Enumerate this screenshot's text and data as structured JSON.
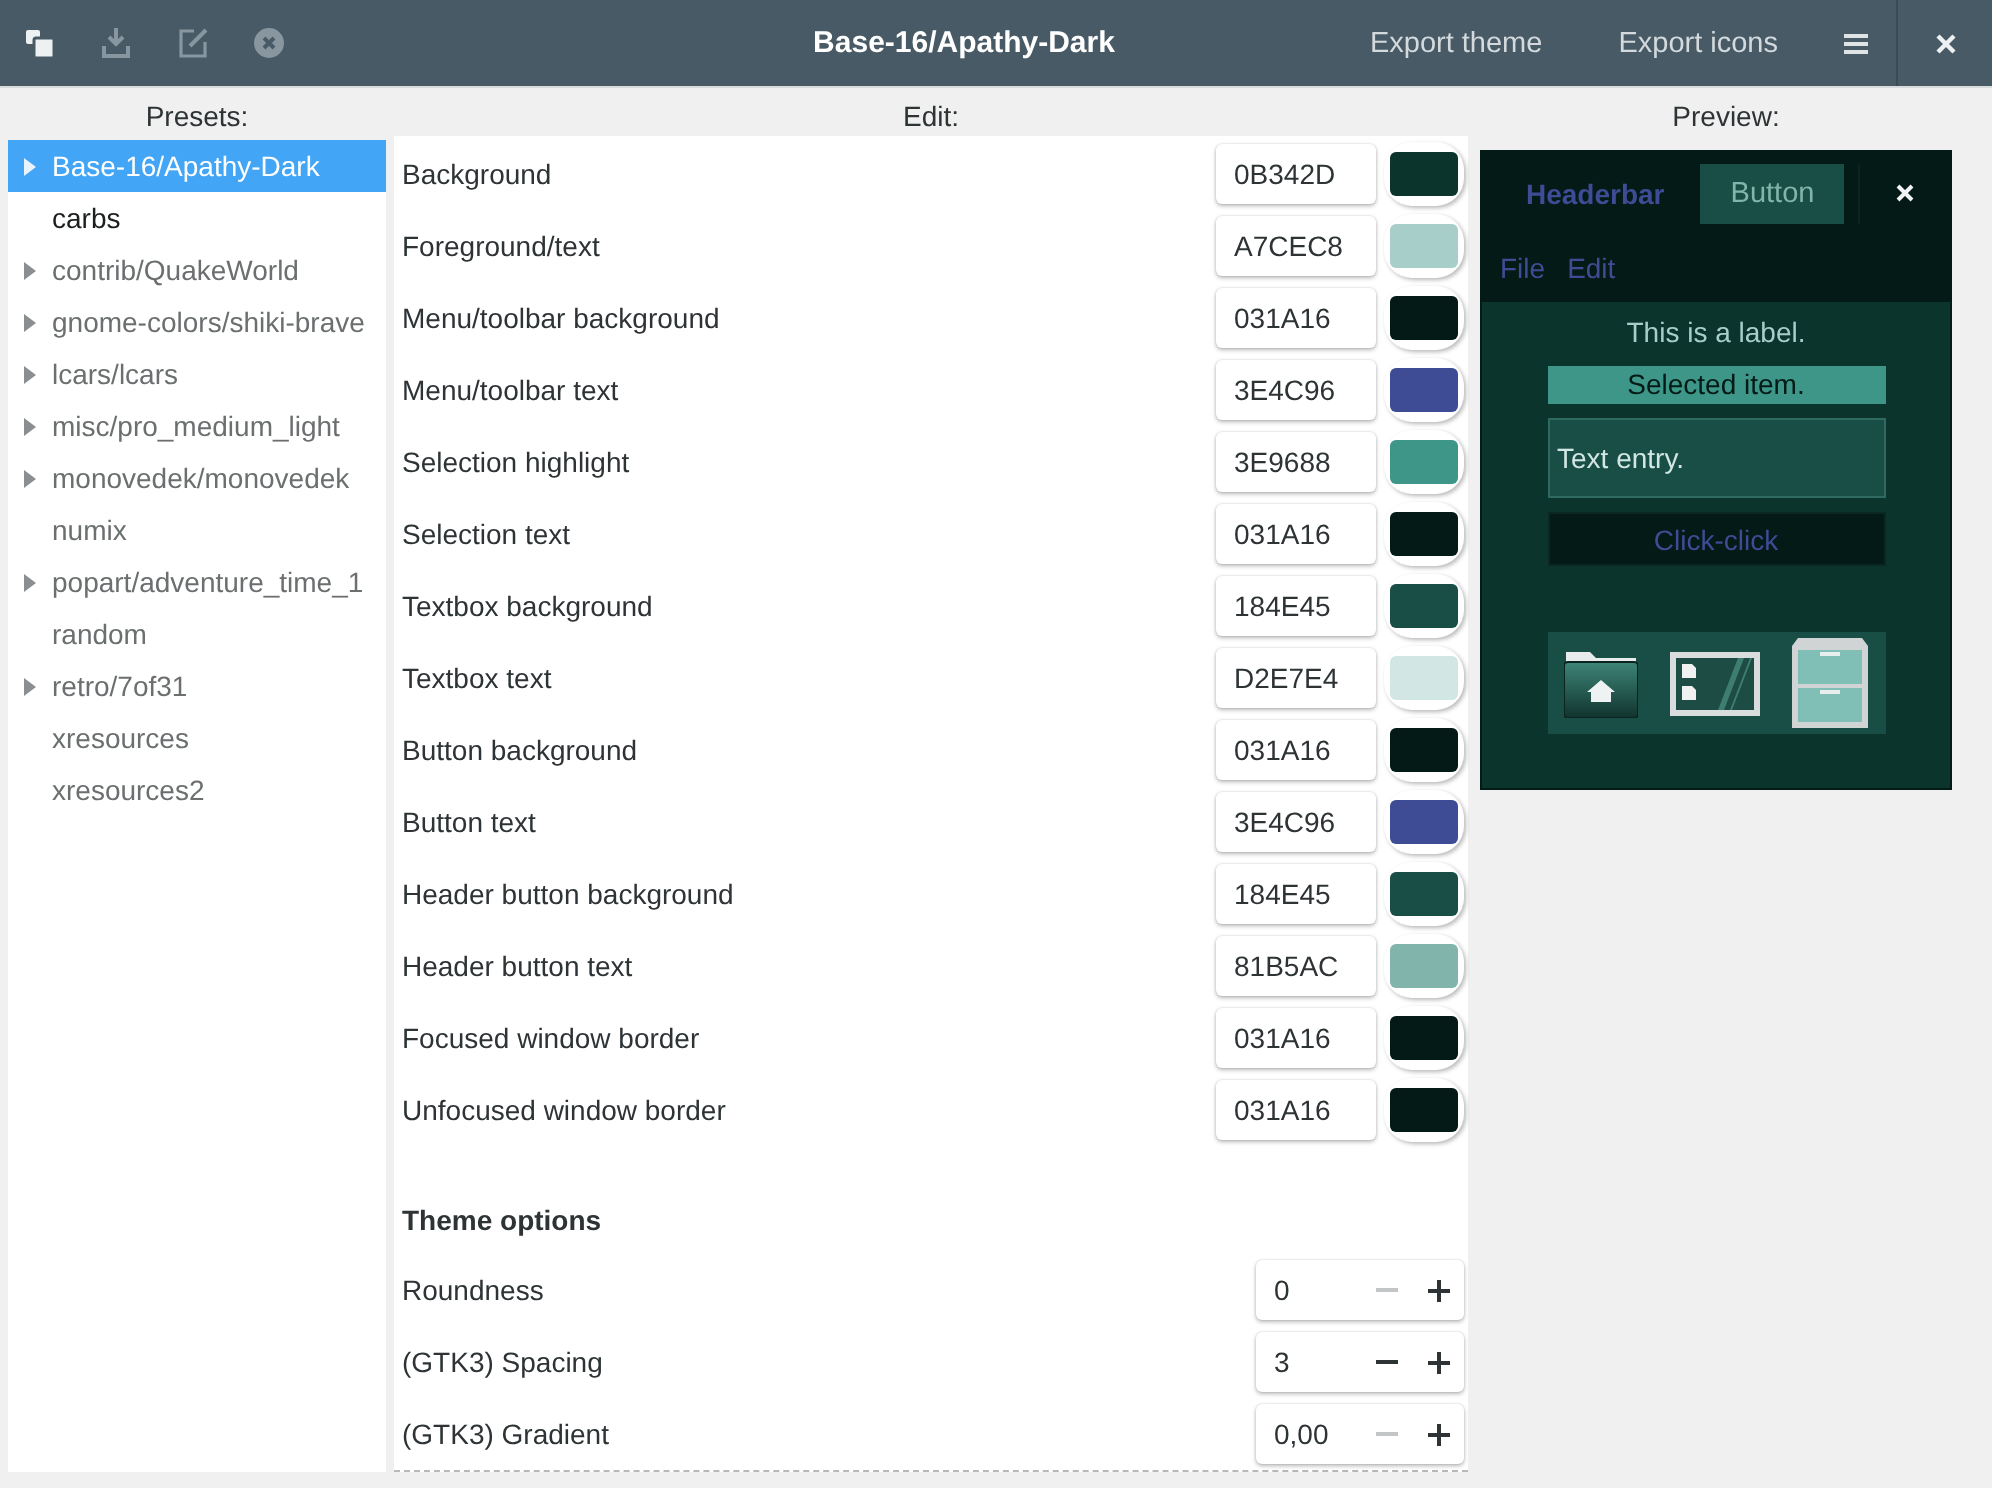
{
  "window": {
    "title": "Base-16/Apathy-Dark"
  },
  "headerbar": {
    "tools": [
      {
        "disabled": false
      },
      {
        "disabled": true
      },
      {
        "disabled": true
      },
      {
        "disabled": true
      }
    ],
    "actions": [
      "Export theme",
      "Export icons"
    ]
  },
  "presets": {
    "label": "Presets:",
    "items": [
      {
        "name": "Base-16/Apathy-Dark",
        "kind": "group",
        "expanded": false,
        "selected": true,
        "hovered": false
      },
      {
        "name": "carbs",
        "kind": "leaf",
        "selected": false,
        "hovered": true
      },
      {
        "name": "contrib/QuakeWorld",
        "kind": "group",
        "expanded": false,
        "selected": false,
        "hovered": false
      },
      {
        "name": "gnome-colors/shiki-brave",
        "kind": "group",
        "expanded": false,
        "selected": false,
        "hovered": false
      },
      {
        "name": "lcars/lcars",
        "kind": "group",
        "expanded": false,
        "selected": false,
        "hovered": false
      },
      {
        "name": "misc/pro_medium_light",
        "kind": "group",
        "expanded": false,
        "selected": false,
        "hovered": false
      },
      {
        "name": "monovedek/monovedek",
        "kind": "group",
        "expanded": false,
        "selected": false,
        "hovered": false
      },
      {
        "name": "numix",
        "kind": "leaf",
        "selected": false,
        "hovered": false
      },
      {
        "name": "popart/adventure_time_1",
        "kind": "group",
        "expanded": false,
        "selected": false,
        "hovered": false
      },
      {
        "name": "random",
        "kind": "leaf",
        "selected": false,
        "hovered": false
      },
      {
        "name": "retro/7of31",
        "kind": "group",
        "expanded": false,
        "selected": false,
        "hovered": false
      },
      {
        "name": "xresources",
        "kind": "leaf",
        "selected": false,
        "hovered": false
      },
      {
        "name": "xresources2",
        "kind": "leaf",
        "selected": false,
        "hovered": false
      }
    ]
  },
  "edit": {
    "label": "Edit:",
    "colors": [
      {
        "name": "Background",
        "value": "0B342D",
        "color": "#0b342d"
      },
      {
        "name": "Foreground/text",
        "value": "A7CEC8",
        "color": "#a7cec8"
      },
      {
        "name": "Menu/toolbar background",
        "value": "031A16",
        "color": "#031a16"
      },
      {
        "name": "Menu/toolbar text",
        "value": "3E4C96",
        "color": "#3e4c96"
      },
      {
        "name": "Selection highlight",
        "value": "3E9688",
        "color": "#3e9688"
      },
      {
        "name": "Selection text",
        "value": "031A16",
        "color": "#031a16"
      },
      {
        "name": "Textbox background",
        "value": "184E45",
        "color": "#184e45"
      },
      {
        "name": "Textbox text",
        "value": "D2E7E4",
        "color": "#d2e7e4"
      },
      {
        "name": "Button background",
        "value": "031A16",
        "color": "#031a16"
      },
      {
        "name": "Button text",
        "value": "3E4C96",
        "color": "#3e4c96"
      },
      {
        "name": "Header button background",
        "value": "184E45",
        "color": "#184e45"
      },
      {
        "name": "Header button text",
        "value": "81B5AC",
        "color": "#81b5ac"
      },
      {
        "name": "Focused window border",
        "value": "031A16",
        "color": "#031a16"
      },
      {
        "name": "Unfocused window border",
        "value": "031A16",
        "color": "#031a16"
      }
    ],
    "options_title": "Theme options",
    "options": [
      {
        "name": "Roundness",
        "value": "0",
        "minus_disabled": true
      },
      {
        "name": "(GTK3) Spacing",
        "value": "3",
        "minus_disabled": false
      },
      {
        "name": "(GTK3) Gradient",
        "value": "0,00",
        "minus_disabled": true
      }
    ]
  },
  "preview": {
    "label": "Preview:",
    "headerbar_title": "Headerbar",
    "header_button": "Button",
    "menu": [
      "File",
      "Edit"
    ],
    "label_text": "This is a label.",
    "selected_item": "Selected item.",
    "text_entry": "Text entry.",
    "button": "Click-click"
  }
}
